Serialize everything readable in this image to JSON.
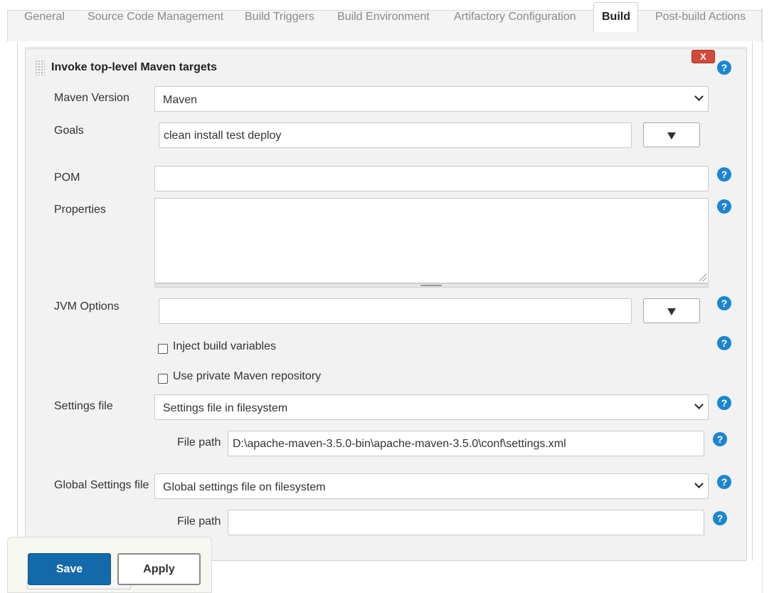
{
  "tabs": [
    {
      "label": "General",
      "active": false
    },
    {
      "label": "Source Code Management",
      "active": false
    },
    {
      "label": "Build Triggers",
      "active": false
    },
    {
      "label": "Build Environment",
      "active": false
    },
    {
      "label": "Artifactory Configuration",
      "active": false
    },
    {
      "label": "Build",
      "active": true
    },
    {
      "label": "Post-build Actions",
      "active": false
    }
  ],
  "step": {
    "title": "Invoke top-level Maven targets",
    "delete_label": "X",
    "help_label": "?"
  },
  "fields": {
    "maven_version": {
      "label": "Maven Version",
      "value": "Maven"
    },
    "goals": {
      "label": "Goals",
      "value": "clean install test deploy"
    },
    "pom": {
      "label": "POM",
      "value": ""
    },
    "properties": {
      "label": "Properties",
      "value": ""
    },
    "jvm_options": {
      "label": "JVM Options",
      "value": ""
    },
    "inject_build_variables": {
      "label": "Inject build variables",
      "checked": false
    },
    "use_private_repo": {
      "label": "Use private Maven repository",
      "checked": false
    },
    "settings_file": {
      "label": "Settings file",
      "value": "Settings file in filesystem",
      "file_path_label": "File path",
      "file_path_value": "D:\\apache-maven-3.5.0-bin\\apache-maven-3.5.0\\conf\\settings.xml"
    },
    "global_settings_file": {
      "label": "Global Settings file",
      "value": "Global settings file on filesystem",
      "file_path_label": "File path",
      "file_path_value": ""
    }
  },
  "buttons": {
    "save": "Save",
    "apply": "Apply"
  },
  "icons": {
    "expand": "triangle-down-icon",
    "select": "chevron-down-icon",
    "help": "help-circle-icon"
  },
  "colors": {
    "save_bg": "#1469ab",
    "delete_bg": "#d24a3a",
    "help_bg": "#1b86d0"
  }
}
